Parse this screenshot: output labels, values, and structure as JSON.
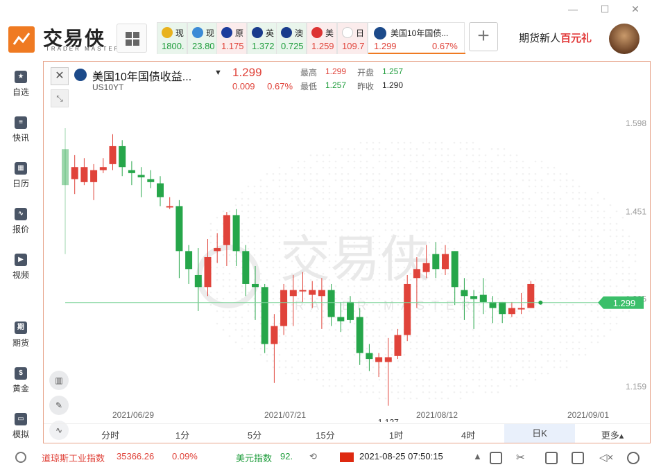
{
  "app": {
    "logo_text": "交易侠",
    "logo_sub": "TRADER MASTER",
    "promo_left": "期货新人",
    "promo_right": "百元礼"
  },
  "window": {
    "minimize": "—",
    "maximize": "☐",
    "close": "✕"
  },
  "tabs": [
    {
      "name": "现",
      "price": "1800.",
      "color": "#1f9d3c",
      "style": "green",
      "icon": "gold-coin-icon"
    },
    {
      "name": "现",
      "price": "23.80",
      "color": "#1f9d3c",
      "style": "green",
      "icon": "silver-icon"
    },
    {
      "name": "原",
      "price": "1.175",
      "color": "#e0433a",
      "style": "red",
      "icon": "eu-flag-icon"
    },
    {
      "name": "英",
      "price": "1.372",
      "color": "#1f9d3c",
      "style": "green",
      "icon": "uk-flag-icon"
    },
    {
      "name": "澳",
      "price": "0.725",
      "color": "#1f9d3c",
      "style": "green",
      "icon": "au-flag-icon"
    },
    {
      "name": "美",
      "price": "1.259",
      "color": "#e0433a",
      "style": "red",
      "icon": "ca-flag-icon"
    },
    {
      "name": "日",
      "price": "109.7",
      "color": "#e0433a",
      "style": "red",
      "icon": "jp-flag-icon"
    }
  ],
  "active_tab": {
    "name": "美国10年国债...",
    "price": "1.299",
    "change": "0.67%",
    "close": "✕"
  },
  "sidebar": [
    {
      "label": "自选",
      "icon": "bookmark-icon",
      "glyph": "★"
    },
    {
      "label": "快讯",
      "icon": "news-icon",
      "glyph": "≡"
    },
    {
      "label": "日历",
      "icon": "calendar-icon",
      "glyph": "▦"
    },
    {
      "label": "报价",
      "icon": "quote-icon",
      "glyph": "∿"
    },
    {
      "label": "视频",
      "icon": "video-icon",
      "glyph": "▶"
    },
    {
      "label": "期货",
      "icon": "futures-icon",
      "glyph": "期"
    },
    {
      "label": "黄金",
      "icon": "gold-icon",
      "glyph": "$"
    },
    {
      "label": "模拟",
      "icon": "simulate-icon",
      "glyph": "▭"
    }
  ],
  "symbol": {
    "name": "美国10年国债收益...",
    "code": "US10YT",
    "last": "1.299",
    "change": "0.009",
    "change_pct": "0.67%",
    "high_label": "最高",
    "high": "1.299",
    "open_label": "开盘",
    "open": "1.257",
    "low_label": "最低",
    "low": "1.257",
    "prev_label": "昨收",
    "prev": "1.290"
  },
  "chart_data": {
    "type": "candlestick",
    "title": "",
    "y_ticks": [
      1.598,
      1.451,
      1.305,
      1.159
    ],
    "ylim": [
      1.1,
      1.62
    ],
    "x_labels": [
      "2021/06/29",
      "2021/07/21",
      "2021/08/12",
      "2021/09/01"
    ],
    "last_price_label": "1.299",
    "low_annotation": "1.127",
    "watermark": "交易侠",
    "watermark_sub": "TRADER MASTER",
    "candles": [
      [
        1.555,
        1.495,
        1.59,
        1.38
      ],
      [
        1.505,
        1.525,
        1.545,
        1.48
      ],
      [
        1.5,
        1.525,
        1.54,
        1.495
      ],
      [
        1.5,
        1.52,
        1.53,
        1.47
      ],
      [
        1.52,
        1.525,
        1.54,
        1.515
      ],
      [
        1.53,
        1.56,
        1.58,
        1.52
      ],
      [
        1.56,
        1.525,
        1.57,
        1.51
      ],
      [
        1.52,
        1.515,
        1.535,
        1.495
      ],
      [
        1.512,
        1.508,
        1.525,
        1.475
      ],
      [
        1.505,
        1.5,
        1.52,
        1.49
      ],
      [
        1.498,
        1.475,
        1.51,
        1.46
      ],
      [
        1.46,
        1.46,
        1.475,
        1.455
      ],
      [
        1.46,
        1.385,
        1.47,
        1.34
      ],
      [
        1.385,
        1.355,
        1.395,
        1.33
      ],
      [
        1.345,
        1.325,
        1.39,
        1.285
      ],
      [
        1.325,
        1.375,
        1.405,
        1.31
      ],
      [
        1.385,
        1.39,
        1.415,
        1.365
      ],
      [
        1.395,
        1.445,
        1.45,
        1.36
      ],
      [
        1.445,
        1.385,
        1.455,
        1.36
      ],
      [
        1.385,
        1.33,
        1.395,
        1.31
      ],
      [
        1.33,
        1.325,
        1.36,
        1.27
      ],
      [
        1.325,
        1.23,
        1.33,
        1.215
      ],
      [
        1.23,
        1.26,
        1.28,
        1.165
      ],
      [
        1.26,
        1.32,
        1.33,
        1.245
      ],
      [
        1.31,
        1.32,
        1.345,
        1.26
      ],
      [
        1.318,
        1.32,
        1.35,
        1.3
      ],
      [
        1.312,
        1.32,
        1.335,
        1.29
      ],
      [
        1.31,
        1.32,
        1.34,
        1.255
      ],
      [
        1.32,
        1.275,
        1.33,
        1.26
      ],
      [
        1.275,
        1.268,
        1.3,
        1.25
      ],
      [
        1.3,
        1.27,
        1.31,
        1.265
      ],
      [
        1.275,
        1.215,
        1.29,
        1.195
      ],
      [
        1.215,
        1.205,
        1.23,
        1.185
      ],
      [
        1.2,
        1.208,
        1.215,
        1.175
      ],
      [
        1.2,
        1.208,
        1.24,
        1.127
      ],
      [
        1.21,
        1.245,
        1.255,
        1.205
      ],
      [
        1.245,
        1.33,
        1.345,
        1.235
      ],
      [
        1.34,
        1.355,
        1.375,
        1.29
      ],
      [
        1.35,
        1.365,
        1.395,
        1.34
      ],
      [
        1.38,
        1.355,
        1.4,
        1.34
      ],
      [
        1.355,
        1.38,
        1.395,
        1.345
      ],
      [
        1.385,
        1.325,
        1.385,
        1.295
      ],
      [
        1.32,
        1.31,
        1.34,
        1.27
      ],
      [
        1.31,
        1.305,
        1.32,
        1.255
      ],
      [
        1.312,
        1.3,
        1.34,
        1.28
      ],
      [
        1.3,
        1.29,
        1.31,
        1.265
      ],
      [
        1.3,
        1.28,
        1.3,
        1.265
      ],
      [
        1.28,
        1.29,
        1.3,
        1.275
      ],
      [
        1.29,
        1.29,
        1.315,
        1.28
      ],
      [
        1.29,
        1.33,
        1.335,
        1.29
      ]
    ]
  },
  "tools": [
    "candle-type-icon",
    "draw-icon",
    "indicator-icon"
  ],
  "intervals": [
    "分时",
    "1分",
    "5分",
    "15分",
    "1时",
    "4时",
    "日K",
    "更多"
  ],
  "active_interval": "日K",
  "status": {
    "index1_name": "道琼斯工业指数",
    "index1_value": "35366.26",
    "index1_change": "0.09%",
    "index2_name": "美元指数",
    "index2_value": "92.",
    "datetime": "2021-08-25 07:50:15"
  }
}
